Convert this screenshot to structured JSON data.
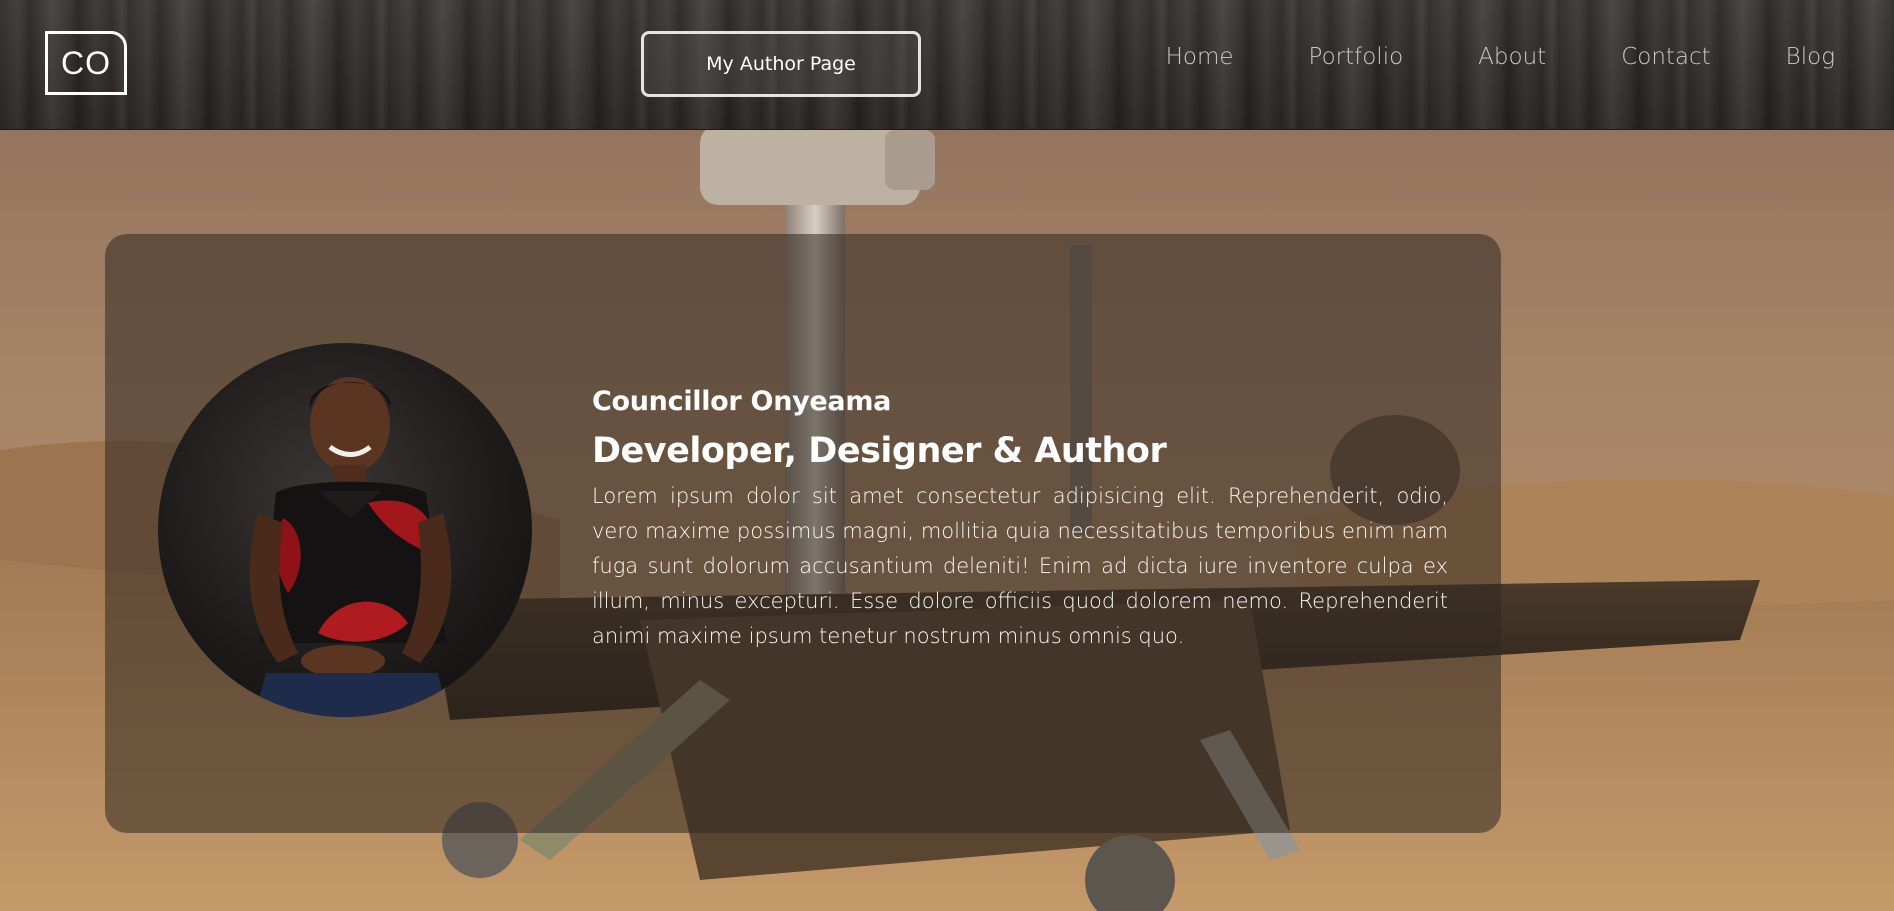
{
  "header": {
    "logo_text": "CO",
    "author_button_label": "My Author Page",
    "nav": [
      {
        "label": "Home"
      },
      {
        "label": "Portfolio"
      },
      {
        "label": "About"
      },
      {
        "label": "Contact"
      },
      {
        "label": "Blog"
      }
    ]
  },
  "profile": {
    "name": "Councillor Onyeama",
    "role": "Developer, Designer & Author",
    "bio": "Lorem ipsum dolor sit amet consectetur adipisicing elit. Reprehenderit, odio, vero maxime possimus magni, mollitia quia necessitatibus temporibus enim nam fuga sunt dolorum accusantium deleniti! Enim ad dicta iure inventore culpa ex illum, minus excepturi. Esse dolore officiis quod dolorem nemo. Reprehenderit animi maxime ipsum tenetur nostrum minus omnis quo."
  },
  "colors": {
    "text": "#ffffff",
    "nav_text": "#cfcac6",
    "card_overlay": "#322821",
    "sky": "#7f6250",
    "sand": "#b0865c"
  }
}
